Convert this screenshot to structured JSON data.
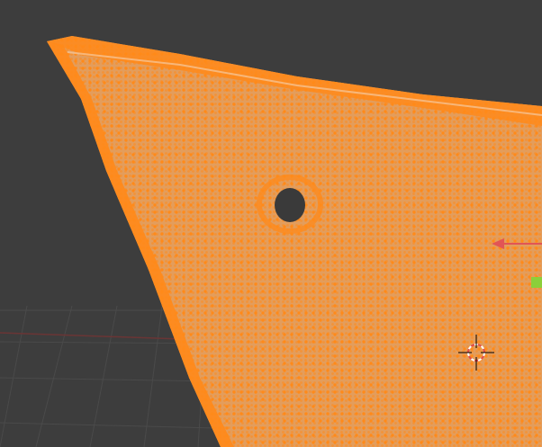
{
  "viewport": {
    "background_color": "#3d3d3d",
    "grid_color": "#4a4a4a",
    "mesh_fill_color": "#e39d5c",
    "vertex_color": "#ff8a1a",
    "selection_mode": "vertex",
    "all_vertices_selected": true,
    "x_axis_color": "#e25555",
    "y_axis_color": "#8ccf3a",
    "cursor_color": "#ffffff",
    "cursor_ring_color": "#e24a4a"
  },
  "icons": {
    "cursor": "3d-cursor-icon",
    "gizmo": "transform-gizmo-icon"
  }
}
